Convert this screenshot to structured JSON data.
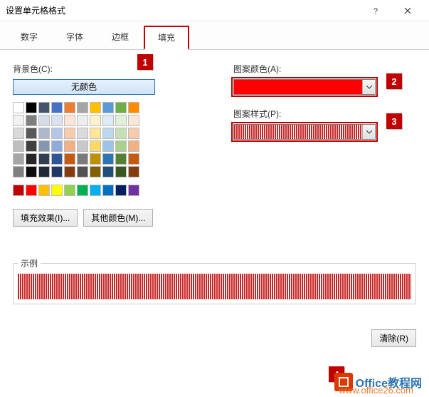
{
  "titlebar": {
    "title": "设置单元格格式"
  },
  "tabs": {
    "number": "数字",
    "font": "字体",
    "border": "边框",
    "fill": "填充"
  },
  "labels": {
    "bgcolor": "背景色(C):",
    "nocolor": "无颜色",
    "patterncolor": "图案颜色(A):",
    "patternstyle": "图案样式(P):",
    "sample": "示例"
  },
  "buttons": {
    "filleffect": "填充效果(I)...",
    "othercolor": "其他颜色(M)...",
    "clear": "清除(R)"
  },
  "callouts": {
    "c1": "1",
    "c2": "2",
    "c3": "3",
    "c4": "4"
  },
  "palette_main": [
    [
      "#ffffff",
      "#000000",
      "#44546a",
      "#4472c4",
      "#ed7d31",
      "#a5a5a5",
      "#ffc000",
      "#5b9bd5",
      "#70ad47",
      "#ff8c00"
    ],
    [
      "#f2f2f2",
      "#7f7f7f",
      "#d6dce5",
      "#d9e2f3",
      "#fbe5d6",
      "#ededed",
      "#fff2cc",
      "#deebf7",
      "#e2f0d9",
      "#fce4d6"
    ],
    [
      "#d9d9d9",
      "#595959",
      "#adb9ca",
      "#b4c7e7",
      "#f8cbad",
      "#dbdbdb",
      "#ffe699",
      "#bdd7ee",
      "#c5e0b4",
      "#f8cbad"
    ],
    [
      "#bfbfbf",
      "#404040",
      "#8497b0",
      "#8faadc",
      "#f4b183",
      "#c9c9c9",
      "#ffd966",
      "#9dc3e6",
      "#a9d18e",
      "#f4b183"
    ],
    [
      "#a6a6a6",
      "#262626",
      "#333f50",
      "#2e5597",
      "#c55a11",
      "#7b7b7b",
      "#bf9000",
      "#2e75b6",
      "#548235",
      "#c55a11"
    ],
    [
      "#808080",
      "#0d0d0d",
      "#222a35",
      "#1f3864",
      "#843c0c",
      "#525252",
      "#806000",
      "#1f4e79",
      "#385723",
      "#843c0c"
    ]
  ],
  "palette_accent": [
    "#c00000",
    "#ff0000",
    "#ffc000",
    "#ffff00",
    "#92d050",
    "#00b050",
    "#00b0f0",
    "#0070c0",
    "#002060",
    "#7030a0"
  ],
  "watermark": {
    "brand": "Office教程网",
    "url": "www.office26.com"
  }
}
